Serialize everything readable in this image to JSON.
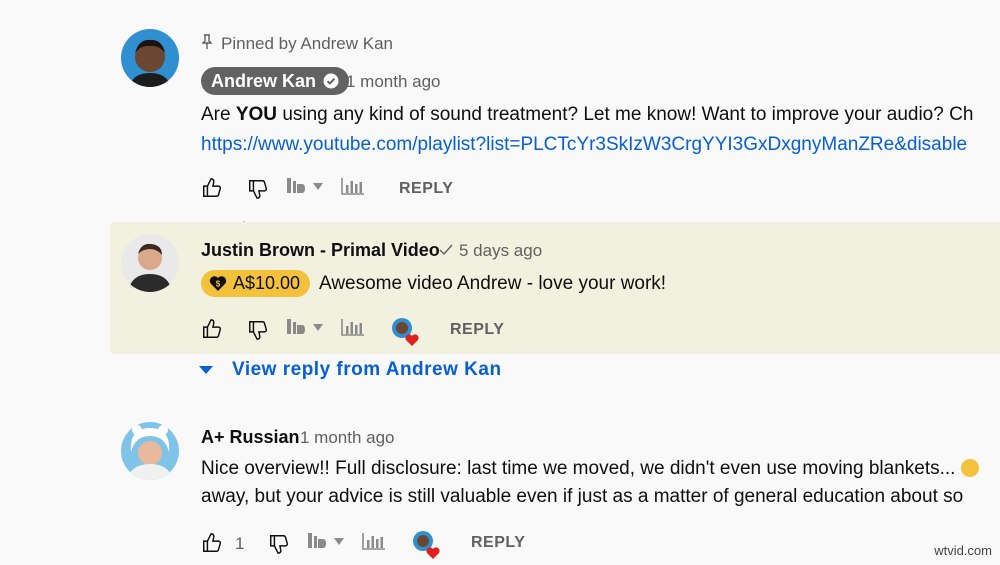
{
  "comments": [
    {
      "pinned_label": "Pinned by Andrew Kan",
      "author": "Andrew Kan",
      "time": "1 month ago",
      "text_parts": [
        "Are ",
        "YOU",
        " using any kind of sound treatment? Let me know! Want to improve your audio? Ch"
      ],
      "link": "https://www.youtube.com/playlist?list=PLCTcYr3SkIzW3CrgYYI3GxDxgnyManZRe&disable",
      "reply_label": "REPLY"
    },
    {
      "author": "Justin Brown - Primal Video",
      "time": "5 days ago",
      "donation": "A$10.00",
      "text": "Awesome video Andrew - love your work!",
      "reply_label": "REPLY",
      "view_reply_label": "View reply from Andrew Kan"
    },
    {
      "author": "A+ Russian",
      "time": "1 month ago",
      "text_line1": "Nice overview!! Full disclosure: last time we moved, we didn't even use moving blankets...",
      "text_line2": "away, but your advice is still valuable even if just as a matter of general education about so",
      "like_count": "1",
      "reply_label": "REPLY"
    }
  ],
  "watermark": "wtvid.com",
  "colors": {
    "link": "#065fd4",
    "highlight_bg": "#f2f1df",
    "donation_bg": "#f3c13a",
    "owner_pill_bg": "#626262",
    "heart": "#e0201c"
  }
}
